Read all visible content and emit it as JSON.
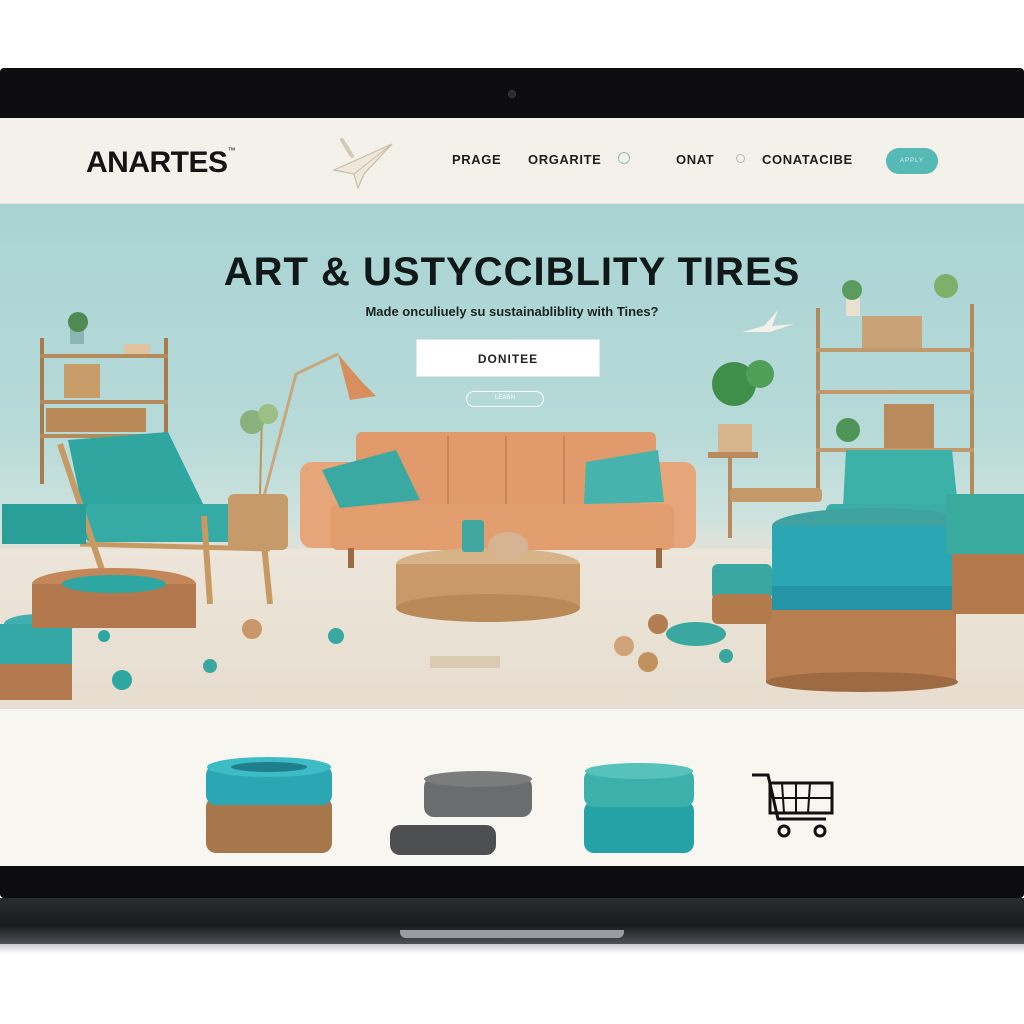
{
  "site": {
    "logo": "ANARTES",
    "logo_mark": "™"
  },
  "nav": {
    "items": [
      "PRAGE",
      "ORGARITE",
      "ONAT",
      "CONATACIBE"
    ],
    "cta_label": "APPLY"
  },
  "hero": {
    "title": "ART & USTYCCIBLITY TIRES",
    "subtitle": "Made onculiuely su sustainabliblity with Tines?",
    "primary_button": "DONITEE",
    "secondary_link": "LEARN"
  },
  "icons": [
    "paper-plane-icon",
    "shopping-cart-icon"
  ],
  "colors": {
    "accent_teal": "#56b9b5",
    "hero_bg": "#a9d4d4",
    "sofa": "#e0996f",
    "tire_teal": "#2aa7b3",
    "tire_brown": "#a9734c",
    "dark": "#141414"
  }
}
